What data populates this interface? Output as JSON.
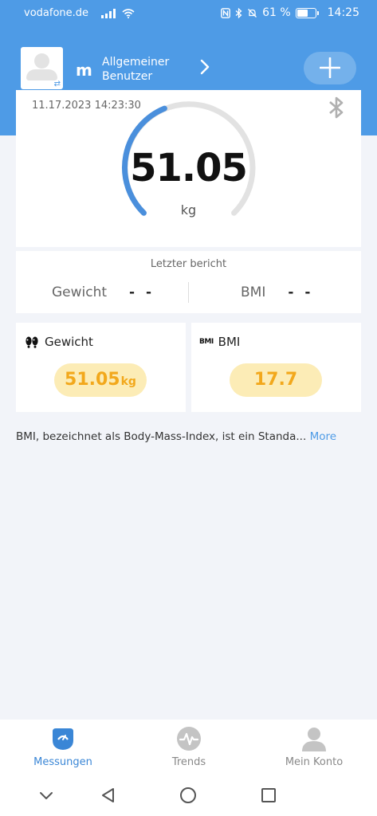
{
  "status_bar": {
    "carrier": "vodafone.de",
    "battery_percent": "61 %",
    "battery_level": 0.61,
    "time": "14:25"
  },
  "header": {
    "user_initial": "m",
    "user_name": "Allgemeiner Benutzer"
  },
  "measurement": {
    "datetime": "11.17.2023 14:23:30",
    "weight": "51.05",
    "unit": "kg"
  },
  "last_report": {
    "title": "Letzter bericht",
    "weight_label": "Gewicht",
    "weight_value": "- -",
    "bmi_label": "BMI",
    "bmi_value": "- -"
  },
  "metrics": {
    "weight_label": "Gewicht",
    "weight_value": "51.05",
    "weight_unit": "kg",
    "bmi_tag": "BMI",
    "bmi_label": "BMI",
    "bmi_value": "17.7"
  },
  "info": {
    "text": "BMI, bezeichnet als Body-Mass-Index, ist ein Standa...",
    "more": "More"
  },
  "tabs": [
    {
      "label": "Messungen",
      "icon": "scale-icon",
      "active": true
    },
    {
      "label": "Trends",
      "icon": "pulse-icon",
      "active": false
    },
    {
      "label": "Mein Konto",
      "icon": "person-icon",
      "active": false
    }
  ],
  "colors": {
    "accent": "#4e9be6",
    "highlight": "#f2a81c",
    "pill_bg": "#fcecb6"
  }
}
